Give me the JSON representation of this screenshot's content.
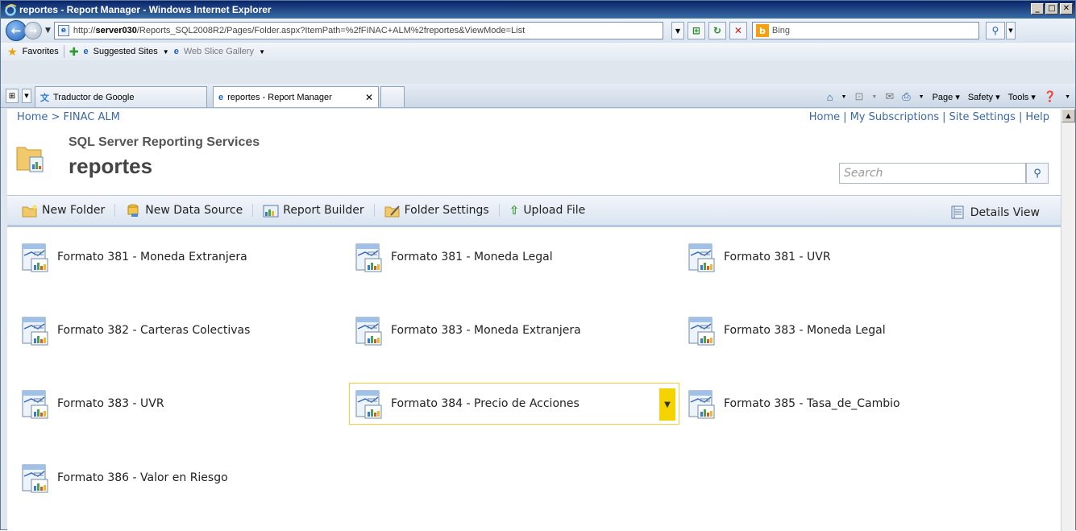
{
  "window": {
    "title": "reportes - Report Manager - Windows Internet Explorer",
    "buttons": {
      "minimize": "_",
      "maximize": "□",
      "close": "✕"
    }
  },
  "addressbar": {
    "url_prefix": "http://",
    "url_host": "server030",
    "url_path": "/Reports_SQL2008R2/Pages/Folder.aspx?ItemPath=%2fFINAC+ALM%2freportes&ViewMode=List",
    "search_engine": "Bing"
  },
  "favorites_bar": {
    "favorites_label": "Favorites",
    "suggested_sites": "Suggested Sites",
    "web_slice_gallery": "Web Slice Gallery"
  },
  "tabs": [
    {
      "label": "Traductor de Google"
    },
    {
      "label": "reportes - Report Manager"
    }
  ],
  "command_bar": {
    "page": "Page",
    "safety": "Safety",
    "tools": "Tools"
  },
  "breadcrumb": "Home > FINAC ALM",
  "top_links": [
    "Home",
    "My Subscriptions",
    "Site Settings",
    "Help"
  ],
  "header": {
    "product": "SQL Server Reporting Services",
    "folder_title": "reportes",
    "search_placeholder": "Search"
  },
  "toolbar": {
    "new_folder": "New Folder",
    "new_data_source": "New Data Source",
    "report_builder": "Report Builder",
    "folder_settings": "Folder Settings",
    "upload_file": "Upload File",
    "details_view": "Details View"
  },
  "reports": [
    "Formato 381 - Moneda Extranjera",
    "Formato 381 - Moneda Legal",
    "Formato 381 - UVR",
    "Formato 382 - Carteras Colectivas",
    "Formato 383 - Moneda Extranjera",
    "Formato 383 - Moneda Legal",
    "Formato 383 - UVR",
    "Formato 384 - Precio de Acciones",
    "Formato 385 - Tasa_de_Cambio",
    "Formato 386 - Valor en Riesgo"
  ],
  "selected_report_index": 7,
  "colors": {
    "link": "#3a67a6",
    "selection_border": "#f0cf3a",
    "selection_dropdown": "#f5d300"
  }
}
